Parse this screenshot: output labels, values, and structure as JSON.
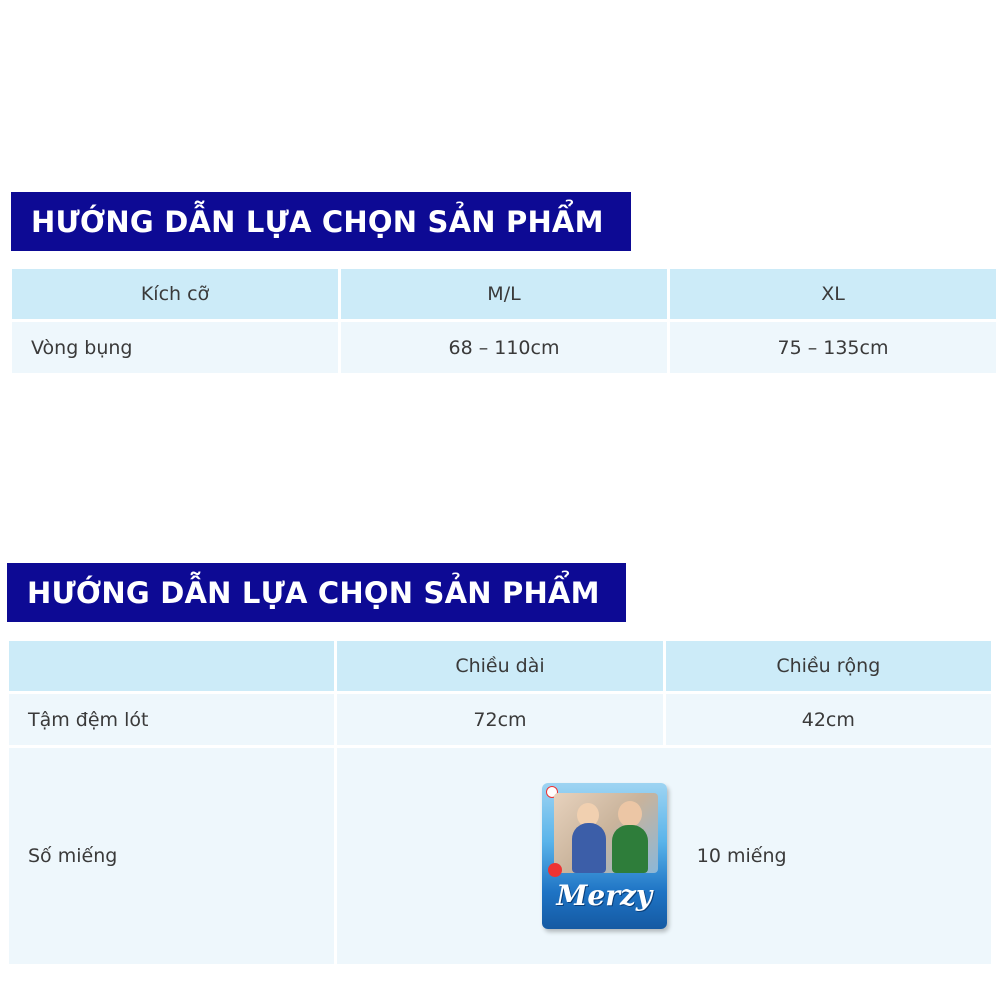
{
  "section1": {
    "title": "HƯỚNG DẪN LỰA CHỌN SẢN PHẨM",
    "header": [
      "Kích cỡ",
      "M/L",
      "XL"
    ],
    "rows": [
      {
        "label": "Vòng bụng",
        "values": [
          "68 – 110cm",
          "75 – 135cm"
        ]
      }
    ]
  },
  "section2": {
    "title": "HƯỚNG DẪN LỰA CHỌN SẢN PHẨM",
    "header": [
      "",
      "Chiều dài",
      "Chiều rộng"
    ],
    "rows": [
      {
        "label": "Tậm đệm lót",
        "values": [
          "72cm",
          "42cm"
        ]
      },
      {
        "label": "Số miếng",
        "product_logo": "Merzy",
        "count": "10 miếng"
      }
    ]
  },
  "colors": {
    "banner": "#0d0a94",
    "header_cell": "#ccebf8",
    "body_cell": "#eef7fc"
  }
}
